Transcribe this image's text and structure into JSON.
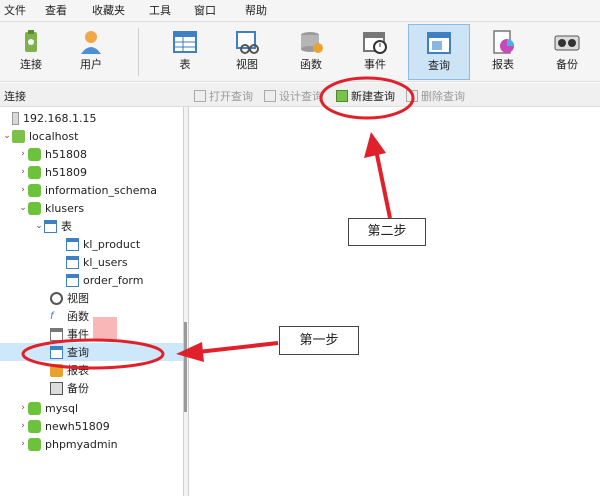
{
  "menu": [
    "文件",
    "查看",
    "收藏夹",
    "工具",
    "窗口",
    "帮助"
  ],
  "toolbar": {
    "connect": "连接",
    "user": "用户",
    "table": "表",
    "view": "视图",
    "function": "函数",
    "event": "事件",
    "query": "查询",
    "report": "报表",
    "backup": "备份"
  },
  "subbar": {
    "label": "连接",
    "open_query": "打开查询",
    "design_query": "设计查询",
    "new_query": "新建查询",
    "delete_query": "删除查询"
  },
  "tree": {
    "server1": "192.168.1.15",
    "server2": "localhost",
    "db1": "h51808",
    "db2": "h51809",
    "db3": "information_schema",
    "db4": "klusers",
    "tables": "表",
    "t1": "kl_product",
    "t2": "kl_users",
    "t3": "order_form",
    "views": "视图",
    "functions": "函数",
    "events": "事件",
    "queries": "查询",
    "reports": "报表",
    "backups": "备份",
    "db5": "mysql",
    "db6": "newh51809",
    "db7": "phpmyadmin"
  },
  "annotations": {
    "step1": "第一步",
    "step2": "第二步"
  },
  "colors": {
    "annotation_red": "#e0202a",
    "selected_bg": "#cde8fb",
    "db_green": "#6cc23a"
  }
}
